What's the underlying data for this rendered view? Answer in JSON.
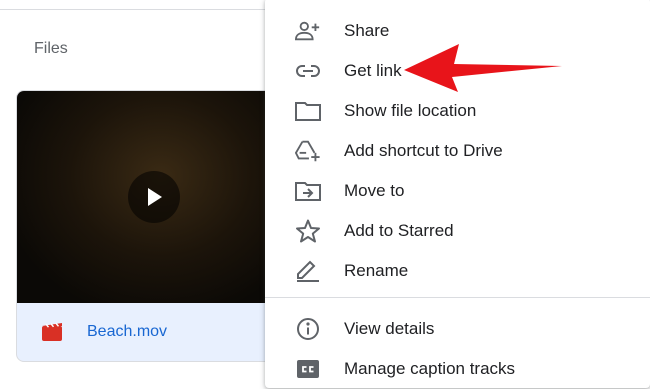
{
  "files_section": {
    "title": "Files",
    "file": {
      "name": "Beach.mov",
      "type_icon": "video-file-icon"
    }
  },
  "context_menu": {
    "items": [
      {
        "label": "Share",
        "icon": "person-add-icon"
      },
      {
        "label": "Get link",
        "icon": "link-icon"
      },
      {
        "label": "Show file location",
        "icon": "folder-icon"
      },
      {
        "label": "Add shortcut to Drive",
        "icon": "add-to-drive-icon"
      },
      {
        "label": "Move to",
        "icon": "move-to-folder-icon"
      },
      {
        "label": "Add to Starred",
        "icon": "star-icon"
      },
      {
        "label": "Rename",
        "icon": "pencil-icon"
      },
      {
        "label": "View details",
        "icon": "info-icon"
      },
      {
        "label": "Manage caption tracks",
        "icon": "closed-caption-icon"
      }
    ]
  },
  "colors": {
    "link_text": "#1967d2",
    "selected_card": "#e8f0fe",
    "annotation_arrow": "#e8141a",
    "video_icon": "#d93025"
  }
}
